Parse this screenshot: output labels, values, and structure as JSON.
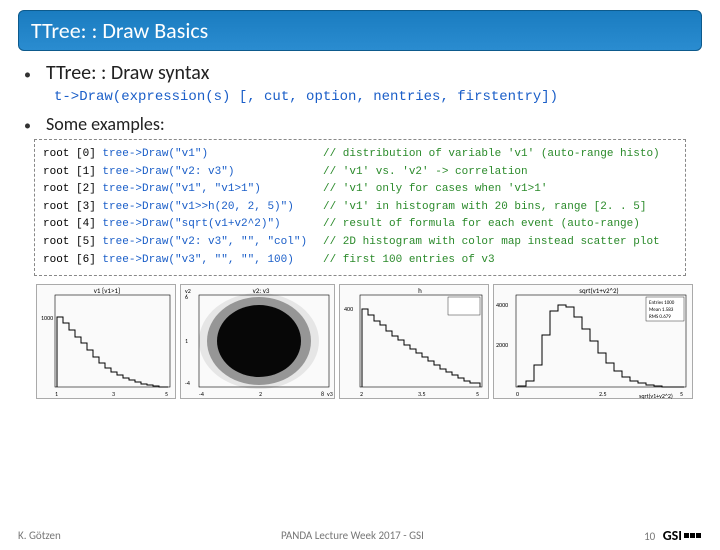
{
  "title": "TTree: : Draw Basics",
  "bullets": {
    "syntax": "TTree: : Draw syntax",
    "examples": "Some examples:"
  },
  "syntax_line": "t->Draw(expression(s) [, cut, option, nentries, firstentry])",
  "code": [
    {
      "prompt": "root [0] ",
      "call": "tree->Draw(\"v1\")",
      "comment": "// distribution of variable 'v1' (auto-range histo)"
    },
    {
      "prompt": "root [1] ",
      "call": "tree->Draw(\"v2: v3\")",
      "comment": "// 'v1' vs. 'v2' -> correlation"
    },
    {
      "prompt": "root [2] ",
      "call": "tree->Draw(\"v1\", \"v1>1\")",
      "comment": "// 'v1' only for cases when 'v1>1'"
    },
    {
      "prompt": "root [3] ",
      "call": "tree->Draw(\"v1>>h(20, 2, 5)\")",
      "comment": "// 'v1' in histogram with 20 bins, range [2. . 5]"
    },
    {
      "prompt": "root [4] ",
      "call": "tree->Draw(\"sqrt(v1+v2^2)\")",
      "comment": "// result of formula for each event (auto-range)"
    },
    {
      "prompt": "root [5] ",
      "call": "tree->Draw(\"v2: v3\", \"\", \"col\")",
      "comment": "// 2D histogram with color map instead scatter plot"
    },
    {
      "prompt": "root [6] ",
      "call": "tree->Draw(\"v3\", \"\", \"\", 100)",
      "comment": "// first 100 entries of v3"
    }
  ],
  "footer": {
    "author": "K. Götzen",
    "center": "PANDA Lecture Week 2017 - GSI",
    "page": "10",
    "logo": "GSI"
  },
  "chart_data": [
    {
      "type": "bar",
      "title": "v1 {v1>1}",
      "xlim": [
        1,
        5
      ],
      "ylim": [
        0,
        1200
      ],
      "note": "1D histogram peaked near x~1.4, tail to 5",
      "values": [
        1100,
        950,
        780,
        600,
        450,
        330,
        250,
        190,
        140,
        100,
        70,
        50,
        35,
        25,
        18,
        12,
        8,
        5,
        3,
        2
      ]
    },
    {
      "type": "scatter",
      "title": "v2: v3",
      "xlabel": "v3",
      "ylabel": "v2",
      "xlim": [
        -4,
        8
      ],
      "ylim": [
        -4,
        6
      ],
      "note": "dense round blob centred near (1,1)"
    },
    {
      "type": "bar",
      "title": "h",
      "xlim": [
        2,
        5
      ],
      "ylim": [
        0,
        450
      ],
      "note": "20-bin histo decreasing",
      "values": [
        430,
        390,
        350,
        320,
        290,
        260,
        235,
        210,
        190,
        170,
        150,
        135,
        120,
        105,
        90,
        78,
        66,
        55,
        45,
        38
      ]
    },
    {
      "type": "bar",
      "title": "sqrt(v1+v2^2)",
      "xlim": [
        0,
        5
      ],
      "ylim": [
        0,
        4600
      ],
      "stats": {
        "Entries": 1000,
        "Mean": 1.583,
        "RMS": 0.679
      },
      "note": "bell-shaped curve peaked ~1.3",
      "values": [
        0,
        100,
        600,
        1800,
        3400,
        4500,
        4300,
        3600,
        2800,
        2000,
        1400,
        950,
        620,
        400,
        260,
        160,
        95,
        55,
        30,
        15
      ]
    }
  ]
}
